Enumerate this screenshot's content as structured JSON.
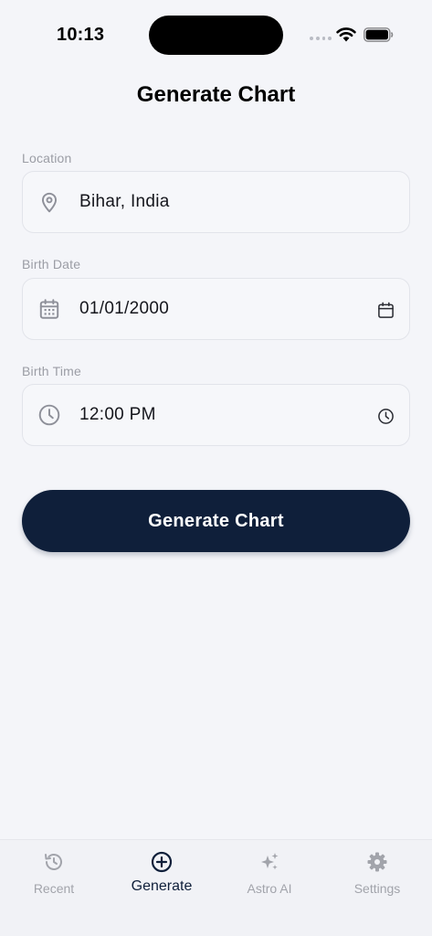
{
  "status": {
    "time": "10:13"
  },
  "header": {
    "title": "Generate Chart"
  },
  "form": {
    "location": {
      "label": "Location",
      "value": "Bihar, India",
      "icon": "map-pin-icon"
    },
    "birth_date": {
      "label": "Birth Date",
      "value": "01/01/2000",
      "icon": "calendar-icon"
    },
    "birth_time": {
      "label": "Birth Time",
      "value": "12:00 PM",
      "icon": "clock-icon"
    }
  },
  "actions": {
    "generate_label": "Generate Chart"
  },
  "colors": {
    "background": "#f4f5f9",
    "primary": "#0f1f3a",
    "muted": "#a2a4ab"
  },
  "tabs": [
    {
      "label": "Recent",
      "icon": "history-icon",
      "active": false
    },
    {
      "label": "Generate",
      "icon": "plus-circle-icon",
      "active": true
    },
    {
      "label": "Astro AI",
      "icon": "sparkles-icon",
      "active": false
    },
    {
      "label": "Settings",
      "icon": "gear-icon",
      "active": false
    }
  ]
}
